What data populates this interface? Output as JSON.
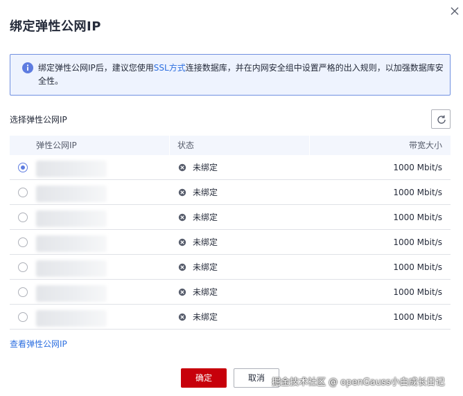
{
  "dialog": {
    "title": "绑定弹性公网IP"
  },
  "alert": {
    "text_before": "绑定弹性公网IP后，建议您使用",
    "link": "SSL方式",
    "text_after": "连接数据库，并在内网安全组中设置严格的出入规则，以加强数据库安全性。"
  },
  "section": {
    "label": "选择弹性公网IP"
  },
  "table": {
    "headers": {
      "ip": "弹性公网IP",
      "status": "状态",
      "bandwidth": "带宽大小"
    },
    "rows": [
      {
        "selected": true,
        "ip": "",
        "status": "未绑定",
        "bandwidth": "1000  Mbit/s"
      },
      {
        "selected": false,
        "ip": "",
        "status": "未绑定",
        "bandwidth": "1000  Mbit/s"
      },
      {
        "selected": false,
        "ip": "",
        "status": "未绑定",
        "bandwidth": "1000  Mbit/s"
      },
      {
        "selected": false,
        "ip": "",
        "status": "未绑定",
        "bandwidth": "1000  Mbit/s"
      },
      {
        "selected": false,
        "ip": "",
        "status": "未绑定",
        "bandwidth": "1000  Mbit/s"
      },
      {
        "selected": false,
        "ip": "",
        "status": "未绑定",
        "bandwidth": "1000  Mbit/s"
      },
      {
        "selected": false,
        "ip": "",
        "status": "未绑定",
        "bandwidth": "1000  Mbit/s"
      }
    ]
  },
  "links": {
    "view_eip": "查看弹性公网IP"
  },
  "buttons": {
    "ok": "确定",
    "cancel": "取消"
  },
  "watermark": "掘金技术社区 @ openGauss小白成长日记",
  "icons": {
    "close": "close-icon",
    "info": "info-icon",
    "refresh": "refresh-icon",
    "status": "unbound-status-icon"
  },
  "colors": {
    "primary_button": "#c7000b",
    "link": "#2d6fe0",
    "alert_bg": "#eef3fe",
    "alert_border": "#6f8fe0",
    "radio_selected": "#5e7ce0"
  }
}
